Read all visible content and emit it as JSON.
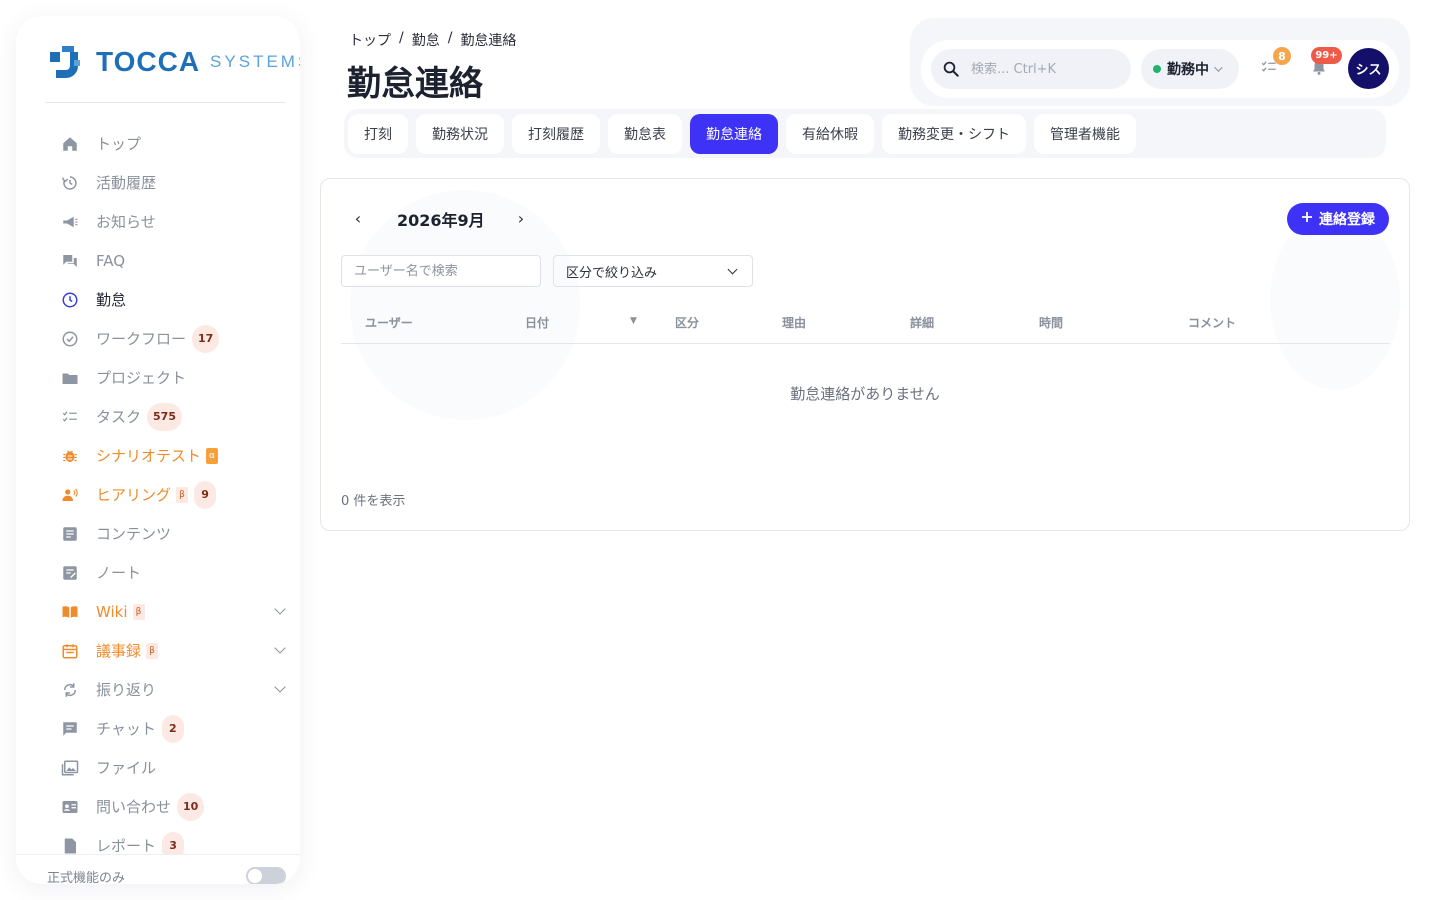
{
  "brand": {
    "name": "TOCCA",
    "sub": "SYSTEMS"
  },
  "sidebar": {
    "items": [
      {
        "label": "トップ"
      },
      {
        "label": "活動履歴"
      },
      {
        "label": "お知らせ"
      },
      {
        "label": "FAQ"
      },
      {
        "label": "勤怠"
      },
      {
        "label": "ワークフロー",
        "badge": "17"
      },
      {
        "label": "プロジェクト"
      },
      {
        "label": "タスク",
        "badge": "575"
      },
      {
        "label": "シナリオテスト",
        "tag": "α"
      },
      {
        "label": "ヒアリング",
        "tag": "β",
        "badge": "9"
      },
      {
        "label": "コンテンツ"
      },
      {
        "label": "ノート"
      },
      {
        "label": "Wiki",
        "tag": "β"
      },
      {
        "label": "議事録",
        "tag": "β"
      },
      {
        "label": "振り返り"
      },
      {
        "label": "チャット",
        "badge": "2"
      },
      {
        "label": "ファイル"
      },
      {
        "label": "問い合わせ",
        "badge": "10"
      },
      {
        "label": "レポート",
        "badge": "3"
      }
    ],
    "footer_label": "正式機能のみ"
  },
  "breadcrumb": [
    "トップ",
    "/",
    "勤怠",
    "/",
    "勤怠連絡"
  ],
  "page_title": "勤怠連絡",
  "topbar": {
    "search_placeholder": "検索... Ctrl+K",
    "status_label": "勤務中",
    "tasks_count": "8",
    "notifications_count": "99+",
    "avatar_text": "シス"
  },
  "tabs": [
    "打刻",
    "勤務状況",
    "打刻履歴",
    "勤怠表",
    "勤怠連絡",
    "有給休暇",
    "勤務変更・シフト",
    "管理者機能"
  ],
  "active_tab": "勤怠連絡",
  "main": {
    "prev": "‹",
    "next": "›",
    "month_label": "2026年9月",
    "add_label": "連絡登録",
    "user_search_placeholder": "ユーザー名で検索",
    "filter_label": "区分で絞り込み",
    "columns": [
      "ユーザー",
      "日付",
      "区分",
      "理由",
      "詳細",
      "時間",
      "コメント"
    ],
    "sort_indicator": "▼",
    "empty_message": "勤怠連絡がありません",
    "result_count": "0 件を表示"
  },
  "colors": {
    "accent": "#3d32f5",
    "brand_blue": "#1f6fb8",
    "beta_orange": "#ef8b2c",
    "status_green": "#1fb36b",
    "avatar_navy": "#14106a"
  }
}
